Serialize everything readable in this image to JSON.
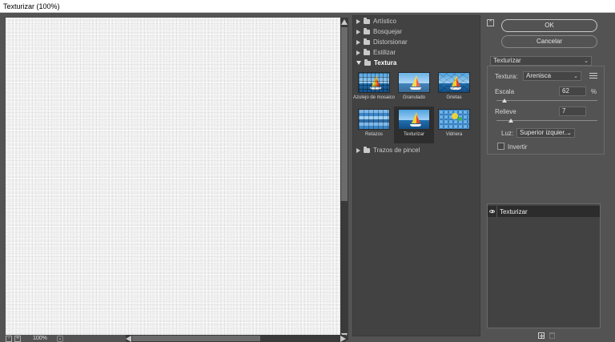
{
  "window": {
    "title": "Texturizar (100%)"
  },
  "preview": {
    "zoom_label": "100%",
    "minus_label": "-",
    "plus_label": "+"
  },
  "gallery": {
    "categories": [
      {
        "label": "Artístico",
        "open": false
      },
      {
        "label": "Bosquejar",
        "open": false
      },
      {
        "label": "Distorsionar",
        "open": false
      },
      {
        "label": "Estilizar",
        "open": false
      },
      {
        "label": "Textura",
        "open": true
      },
      {
        "label": "Trazos de pincel",
        "open": false
      }
    ],
    "textura_filters": [
      {
        "label": "Azulejo de mosaico",
        "selected": false
      },
      {
        "label": "Granulado",
        "selected": false
      },
      {
        "label": "Grietas",
        "selected": false
      },
      {
        "label": "Retazos",
        "selected": false
      },
      {
        "label": "Texturizar",
        "selected": true
      },
      {
        "label": "Vidriera",
        "selected": false
      }
    ]
  },
  "controls": {
    "collapse_label": "⌃",
    "ok_label": "OK",
    "cancel_label": "Cancelar",
    "filter_select": "Texturizar",
    "textura_label": "Textura:",
    "textura_value": "Arenisca",
    "escala_label": "Escala",
    "escala_value": "62",
    "escala_unit": "%",
    "escala_fraction": 0.08,
    "relieve_label": "Relieve",
    "relieve_value": "7",
    "relieve_fraction": 0.14,
    "luz_label": "Luz:",
    "luz_value": "Superior izquier...",
    "invertir_label": "Invertir",
    "invertir_checked": false
  },
  "layers": {
    "items": [
      {
        "label": "Texturizar",
        "visible": true
      }
    ]
  },
  "colors": {
    "panel": "#535353",
    "dark": "#424242",
    "selected": "#2e2e2e"
  }
}
